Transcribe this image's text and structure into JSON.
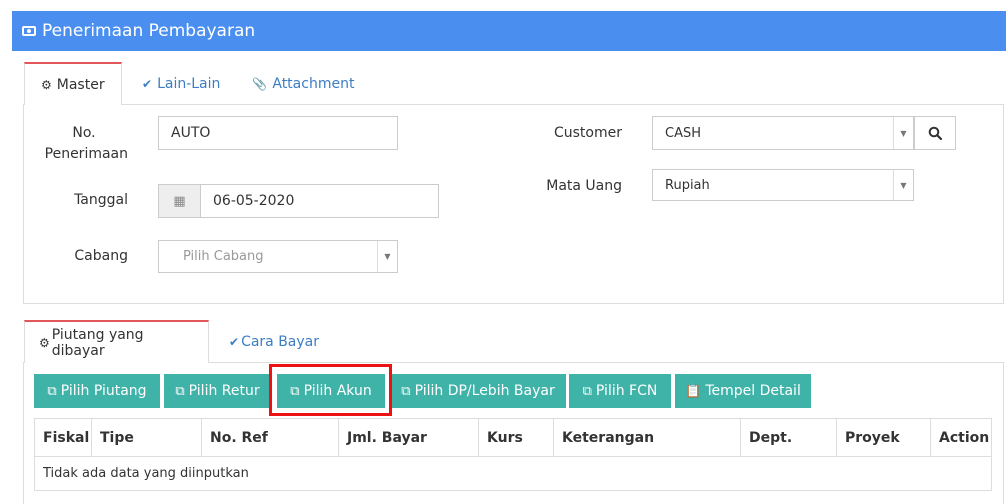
{
  "header": {
    "title": "Penerimaan Pembayaran",
    "icon": "money-icon"
  },
  "top_tabs": [
    {
      "label": "Master",
      "icon": "cogs-icon",
      "active": true
    },
    {
      "label": "Lain-Lain",
      "icon": "check-circle-icon",
      "active": false
    },
    {
      "label": "Attachment",
      "icon": "paperclip-icon",
      "active": false
    }
  ],
  "form": {
    "no_penerimaan_label_1": "No.",
    "no_penerimaan_label_2": "Penerimaan",
    "no_penerimaan_value": "AUTO",
    "tanggal_label": "Tanggal",
    "tanggal_value": "06-05-2020",
    "cabang_label": "Cabang",
    "cabang_placeholder": "Pilih Cabang",
    "customer_label": "Customer",
    "customer_value": "CASH",
    "mata_uang_label": "Mata Uang",
    "mata_uang_value": "Rupiah"
  },
  "bottom_tabs": [
    {
      "label": "Piutang yang dibayar",
      "icon": "cogs-icon",
      "active": true
    },
    {
      "label": "Cara Bayar",
      "icon": "check-circle-icon",
      "active": false
    }
  ],
  "buttons": [
    {
      "label": "Pilih Piutang",
      "icon": "copy-icon"
    },
    {
      "label": "Pilih Retur",
      "icon": "copy-icon"
    },
    {
      "label": "Pilih Akun",
      "icon": "copy-icon"
    },
    {
      "label": "Pilih DP/Lebih Bayar",
      "icon": "copy-icon"
    },
    {
      "label": "Pilih FCN",
      "icon": "copy-icon"
    },
    {
      "label": "Tempel Detail",
      "icon": "paste-icon"
    }
  ],
  "table": {
    "columns": [
      "Fiskal",
      "Tipe",
      "No. Ref",
      "Jml. Bayar",
      "Kurs",
      "Keterangan",
      "Dept.",
      "Proyek",
      "Action"
    ],
    "empty_message": "Tidak ada data yang diinputkan"
  },
  "colors": {
    "header": "#4a8ff0",
    "button": "#40b3a8",
    "highlight": "#ee1111",
    "active_tab": "#e15759"
  }
}
